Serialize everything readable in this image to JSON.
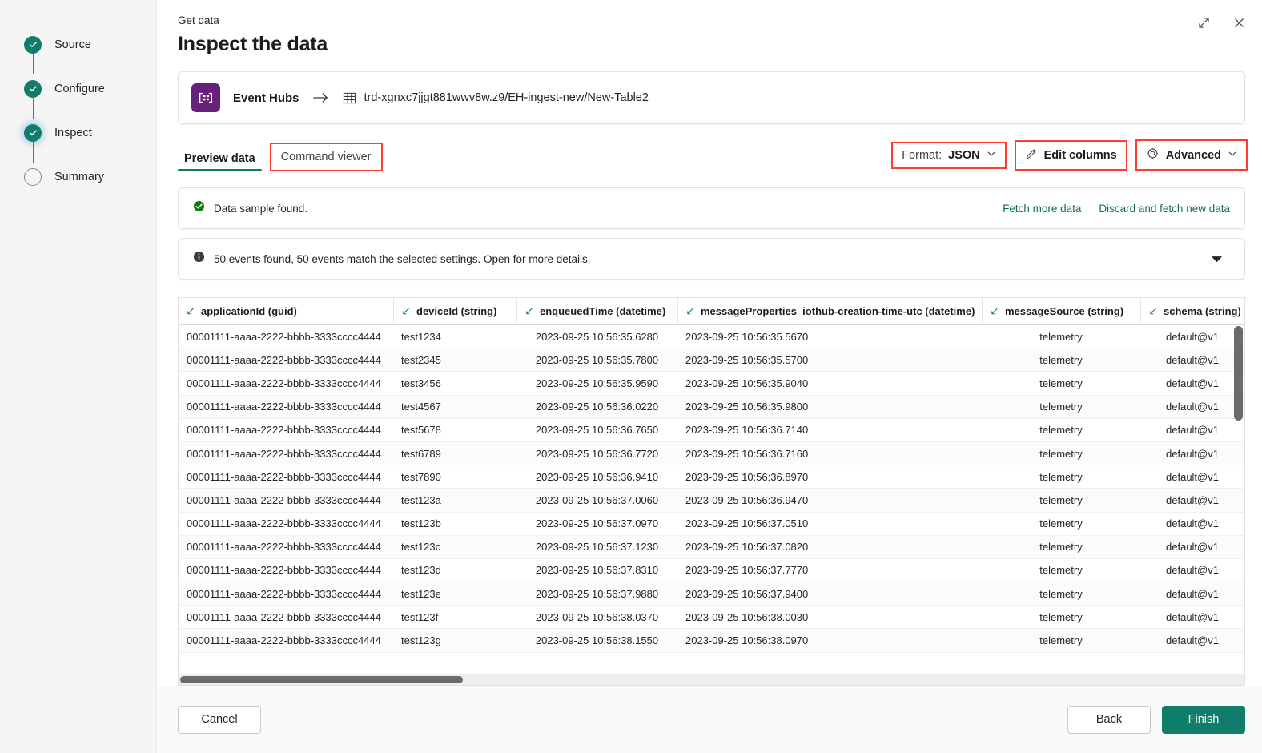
{
  "wizard": {
    "steps": [
      {
        "label": "Source",
        "state": "done"
      },
      {
        "label": "Configure",
        "state": "done"
      },
      {
        "label": "Inspect",
        "state": "current"
      },
      {
        "label": "Summary",
        "state": "todo"
      }
    ]
  },
  "header": {
    "eyebrow": "Get data",
    "title": "Inspect the data",
    "expand_icon": "expand-icon",
    "close_icon": "close-icon"
  },
  "source_card": {
    "icon": "event-hubs-icon",
    "source_name": "Event Hubs",
    "arrow": "arrow-right-icon",
    "target_icon": "table-icon",
    "target_path": "trd-xgnxc7jjgt881wwv8w.z9/EH-ingest-new/New-Table2"
  },
  "tabs": [
    {
      "label": "Preview data",
      "active": true,
      "annotated": false
    },
    {
      "label": "Command viewer",
      "active": false,
      "annotated": true
    }
  ],
  "toolbar": {
    "format_label": "Format:",
    "format_value": "JSON",
    "format_chevron": "chevron-down-icon",
    "edit_columns_label": "Edit columns",
    "edit_columns_icon": "pencil-icon",
    "advanced_label": "Advanced",
    "advanced_icon": "gear-icon",
    "advanced_chevron": "chevron-down-icon"
  },
  "banners": {
    "success": {
      "icon": "success-check-icon",
      "text": "Data sample found.",
      "links": [
        {
          "label": "Fetch more data"
        },
        {
          "label": "Discard and fetch new data"
        }
      ]
    },
    "info": {
      "icon": "info-icon",
      "text": "50 events found, 50 events match the selected settings. Open for more details.",
      "caret": "caret-down-icon"
    }
  },
  "table": {
    "columns": [
      "applicationId (guid)",
      "deviceId (string)",
      "enqueuedTime (datetime)",
      "messageProperties_iothub-creation-time-utc (datetime)",
      "messageSource (string)",
      "schema (string)"
    ],
    "rows": [
      [
        "00001111-aaaa-2222-bbbb-3333cccc4444",
        "test1234",
        "2023-09-25 10:56:35.6280",
        "2023-09-25 10:56:35.5670",
        "telemetry",
        "default@v1"
      ],
      [
        "00001111-aaaa-2222-bbbb-3333cccc4444",
        "test2345",
        "2023-09-25 10:56:35.7800",
        "2023-09-25 10:56:35.5700",
        "telemetry",
        "default@v1"
      ],
      [
        "00001111-aaaa-2222-bbbb-3333cccc4444",
        "test3456",
        "2023-09-25 10:56:35.9590",
        "2023-09-25 10:56:35.9040",
        "telemetry",
        "default@v1"
      ],
      [
        "00001111-aaaa-2222-bbbb-3333cccc4444",
        "test4567",
        "2023-09-25 10:56:36.0220",
        "2023-09-25 10:56:35.9800",
        "telemetry",
        "default@v1"
      ],
      [
        "00001111-aaaa-2222-bbbb-3333cccc4444",
        "test5678",
        "2023-09-25 10:56:36.7650",
        "2023-09-25 10:56:36.7140",
        "telemetry",
        "default@v1"
      ],
      [
        "00001111-aaaa-2222-bbbb-3333cccc4444",
        "test6789",
        "2023-09-25 10:56:36.7720",
        "2023-09-25 10:56:36.7160",
        "telemetry",
        "default@v1"
      ],
      [
        "00001111-aaaa-2222-bbbb-3333cccc4444",
        "test7890",
        "2023-09-25 10:56:36.9410",
        "2023-09-25 10:56:36.8970",
        "telemetry",
        "default@v1"
      ],
      [
        "00001111-aaaa-2222-bbbb-3333cccc4444",
        "test123a",
        "2023-09-25 10:56:37.0060",
        "2023-09-25 10:56:36.9470",
        "telemetry",
        "default@v1"
      ],
      [
        "00001111-aaaa-2222-bbbb-3333cccc4444",
        "test123b",
        "2023-09-25 10:56:37.0970",
        "2023-09-25 10:56:37.0510",
        "telemetry",
        "default@v1"
      ],
      [
        "00001111-aaaa-2222-bbbb-3333cccc4444",
        "test123c",
        "2023-09-25 10:56:37.1230",
        "2023-09-25 10:56:37.0820",
        "telemetry",
        "default@v1"
      ],
      [
        "00001111-aaaa-2222-bbbb-3333cccc4444",
        "test123d",
        "2023-09-25 10:56:37.8310",
        "2023-09-25 10:56:37.7770",
        "telemetry",
        "default@v1"
      ],
      [
        "00001111-aaaa-2222-bbbb-3333cccc4444",
        "test123e",
        "2023-09-25 10:56:37.9880",
        "2023-09-25 10:56:37.9400",
        "telemetry",
        "default@v1"
      ],
      [
        "00001111-aaaa-2222-bbbb-3333cccc4444",
        "test123f",
        "2023-09-25 10:56:38.0370",
        "2023-09-25 10:56:38.0030",
        "telemetry",
        "default@v1"
      ],
      [
        "00001111-aaaa-2222-bbbb-3333cccc4444",
        "test123g",
        "2023-09-25 10:56:38.1550",
        "2023-09-25 10:56:38.0970",
        "telemetry",
        "default@v1"
      ]
    ]
  },
  "footer": {
    "cancel_label": "Cancel",
    "back_label": "Back",
    "finish_label": "Finish"
  },
  "colors": {
    "accent_green": "#107c6a",
    "success_green": "#107c10",
    "brand_purple": "#68217a",
    "annotation_red": "#ff3b30",
    "link_green": "#0f6b5c"
  }
}
